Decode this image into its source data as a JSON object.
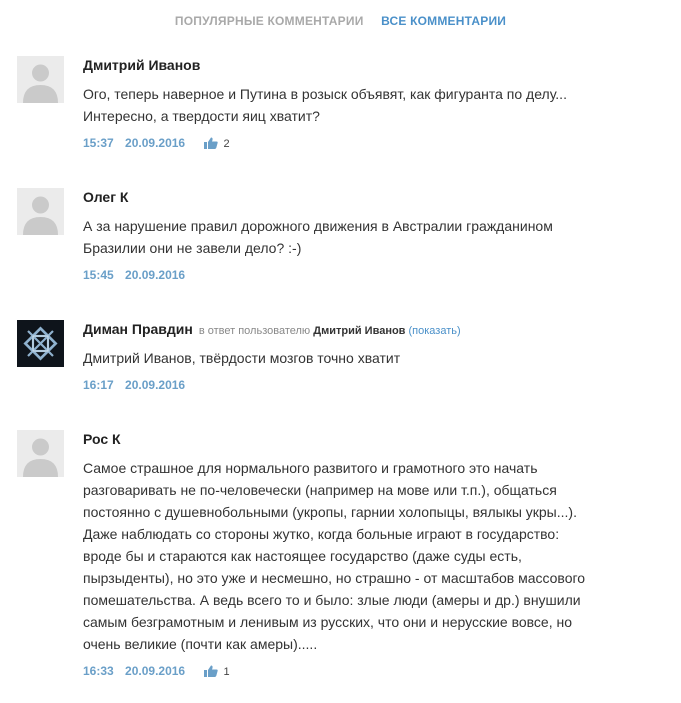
{
  "tabs": {
    "popular": "ПОПУЛЯРНЫЕ КОММЕНТАРИИ",
    "all": "ВСЕ КОММЕНТАРИИ"
  },
  "comments": [
    {
      "author": "Дмитрий Иванов",
      "text_lines": [
        "Ого, теперь наверное и Путина в розыск объявят, как фигуранта по делу...",
        "Интересно, а твердости яиц хватит?"
      ],
      "time": "15:37",
      "date": "20.09.2016",
      "likes": "2"
    },
    {
      "author": "Олег К",
      "text_lines": [
        "А за нарушение правил дорожного движения в Австралии гражданином",
        "Бразилии они не завели дело? :-)"
      ],
      "time": "15:45",
      "date": "20.09.2016"
    },
    {
      "author": "Диман Правдин",
      "reply_prefix": "в ответ пользователю",
      "reply_to": "Дмитрий Иванов",
      "reply_show": "(показать)",
      "text_lines": [
        "Дмитрий Иванов, твёрдости мозгов точно хватит"
      ],
      "time": "16:17",
      "date": "20.09.2016"
    },
    {
      "author": "Рос К",
      "text_lines": [
        "Самое страшное для нормального развитого и грамотного это начать",
        "разговаривать не по-человечески (например на мове или т.п.), общаться",
        "постоянно с душевнобольными (укропы, гарнии холопыцы, вялыкы укры...).",
        "Даже наблюдать со стороны жутко, когда больные играют в государство:",
        "вроде бы и стараются как настоящее государство (даже суды есть,",
        "пырзыденты), но это уже и несмешно, но страшно - от масштабов массового",
        "помешательства. А ведь всего то и было: злые люди (амеры и др.) внушили",
        "самым безграмотным и ленивым из русских, что они и нерусские вовсе, но",
        "очень великие (почти как амеры)....."
      ],
      "time": "16:33",
      "date": "20.09.2016",
      "likes": "1"
    }
  ]
}
